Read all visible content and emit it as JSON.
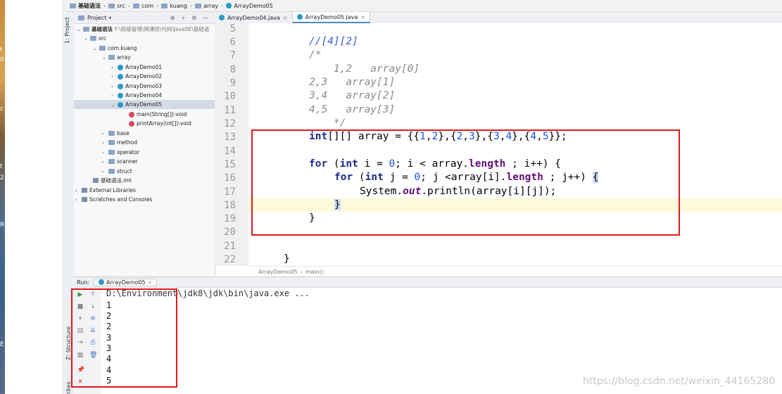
{
  "desktop": {
    "chars": [
      "t",
      "0",
      "c",
      "t",
      "2",
      "R",
      "E"
    ]
  },
  "toolwindow": {
    "project_label": "1: Project",
    "structure_label": "Z: Structure",
    "favorites_label": "rites"
  },
  "nav": {
    "crumbs": [
      "基础语法",
      "src",
      "com",
      "kuang",
      "array",
      "ArrayDemo05"
    ]
  },
  "project": {
    "header": "Project",
    "root": "基础语法",
    "root_path": "F:\\班级管理\\网课班\\代码\\JavaSE\\基础语",
    "items": [
      {
        "label": "src"
      },
      {
        "label": "com.kuang"
      },
      {
        "label": "array"
      },
      {
        "label": "ArrayDemo01"
      },
      {
        "label": "ArrayDemo02"
      },
      {
        "label": "ArrayDemo03"
      },
      {
        "label": "ArrayDemo04"
      },
      {
        "label": "ArrayDemo05"
      },
      {
        "label": "main(String[]):void"
      },
      {
        "label": "printArray(int[]):void"
      },
      {
        "label": "base"
      },
      {
        "label": "method"
      },
      {
        "label": "operator"
      },
      {
        "label": "scanner"
      },
      {
        "label": "struct"
      },
      {
        "label": "基础语法.iml"
      },
      {
        "label": "External Libraries"
      },
      {
        "label": "Scratches and Consoles"
      }
    ]
  },
  "tabs": [
    {
      "label": "ArrayDemo04.java"
    },
    {
      "label": "ArrayDemo05.java"
    }
  ],
  "editor": {
    "line_numbers": [
      "5",
      "6",
      "7",
      "8",
      "9",
      "10",
      "11",
      "12",
      "13",
      "14",
      "15",
      "16",
      "17",
      "18",
      "19",
      "20",
      "21",
      "22"
    ],
    "lines": {
      "l6": "//[4][2]",
      "l7": "/*",
      "l8": "    1,2   array[0]",
      "l9": "2,3   array[1]",
      "l10": "3,4   array[2]",
      "l11": "4,5   array[3]",
      "l12": "    */",
      "l13_kw": "int",
      "l13_rest": "[][] array = {{",
      "l13_vals": [
        "1",
        "2",
        "2",
        "3",
        "3",
        "4",
        "4",
        "5"
      ],
      "l15_for": "for",
      "l15_int": "int",
      "l15_a": " i = ",
      "l15_zero": "0",
      "l15_b": "; i < array.",
      "l15_len": "length",
      "l15_c": " ; i++) {",
      "l16_for": "for",
      "l16_int": "int",
      "l16_a": " j = ",
      "l16_zero": "0",
      "l16_b": "; j <array[i].",
      "l16_len": "length",
      "l16_c": " ; j++) ",
      "l16_brace": "{",
      "l17_a": "System.",
      "l17_out": "out",
      "l17_b": ".println(array[i][j]);",
      "l18": "}",
      "l19": "}",
      "l22": "}"
    },
    "breadcrumb": [
      "ArrayDemo05",
      "main()"
    ]
  },
  "run": {
    "label": "Run:",
    "config": "ArrayDemo05",
    "command": "D:\\Environment\\jdk8\\jdk\\bin\\java.exe ...",
    "output": [
      "1",
      "2",
      "2",
      "3",
      "3",
      "4",
      "4",
      "5"
    ]
  },
  "watermark": "https://blog.csdn.net/weixin_44165280",
  "colors": {
    "highlight": "#e01a1a",
    "keyword": "#1a2a8a",
    "number": "#1750eb",
    "field": "#660e7a"
  }
}
